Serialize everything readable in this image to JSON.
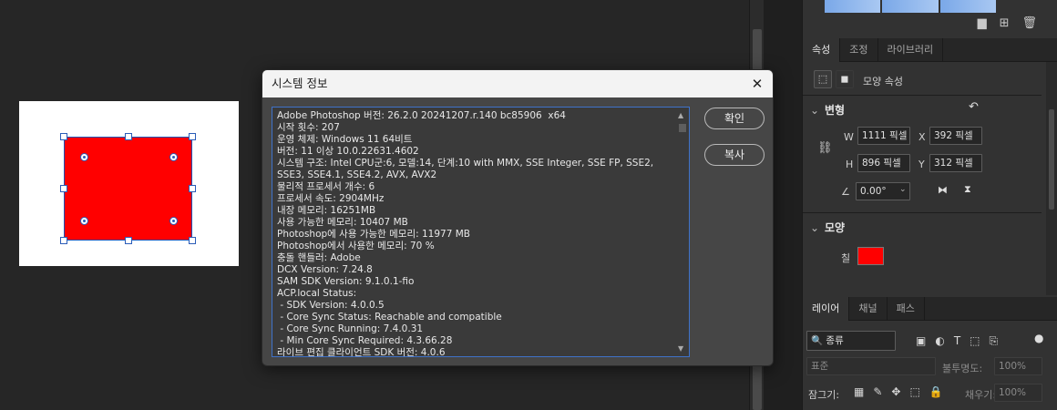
{
  "dialog": {
    "title": "시스템 정보",
    "ok_label": "확인",
    "copy_label": "복사",
    "info_lines": [
      "Adobe Photoshop 버전: 26.2.0 20241207.r.140 bc85906  x64",
      "시작 횟수: 207",
      "운영 체제: Windows 11 64비트",
      "버전: 11 이상 10.0.22631.4602",
      "시스템 구조: Intel CPU군:6, 모델:14, 단계:10 with MMX, SSE Integer, SSE FP, SSE2,",
      "SSE3, SSE4.1, SSE4.2, AVX, AVX2",
      "물리적 프로세서 개수: 6",
      "프로세서 속도: 2904MHz",
      "내장 메모리: 16251MB",
      "사용 가능한 메모리: 10407 MB",
      "Photoshop에 사용 가능한 메모리: 11977 MB",
      "Photoshop에서 사용한 메모리: 70 %",
      "충돌 핸들러: Adobe",
      "DCX Version: 7.24.8",
      "SAM SDK Version: 9.1.0.1-fio",
      "ACP.local Status:",
      " - SDK Version: 4.0.0.5",
      " - Core Sync Status: Reachable and compatible",
      " - Core Sync Running: 7.4.0.31",
      " - Min Core Sync Required: 4.3.66.28",
      "라이브 편집 클라이언트 SDK 버전: 4.0.6"
    ]
  },
  "properties_tabs": [
    "속성",
    "조정",
    "라이브러리"
  ],
  "properties": {
    "shape_props_label": "모양 속성",
    "transform_title": "변형",
    "w_label": "W",
    "w_value": "1111 픽셀",
    "h_label": "H",
    "h_value": "896 픽셀",
    "x_label": "X",
    "x_value": "392 픽셀",
    "y_label": "Y",
    "y_value": "312 픽셀",
    "angle_value": "0.00°",
    "shape_title": "모양",
    "fill_label": "칠",
    "fill_color": "#ff0000"
  },
  "layers_tabs": [
    "레이어",
    "채널",
    "패스"
  ],
  "layers": {
    "filter_label": "종류",
    "blend_mode": "표준",
    "opacity_label": "불투명도:",
    "opacity_value": "100%",
    "lock_label": "잠그기:",
    "fill_label": "채우기:",
    "fill_value": "100%"
  },
  "canvas": {
    "shape_color": "#ff0000"
  }
}
